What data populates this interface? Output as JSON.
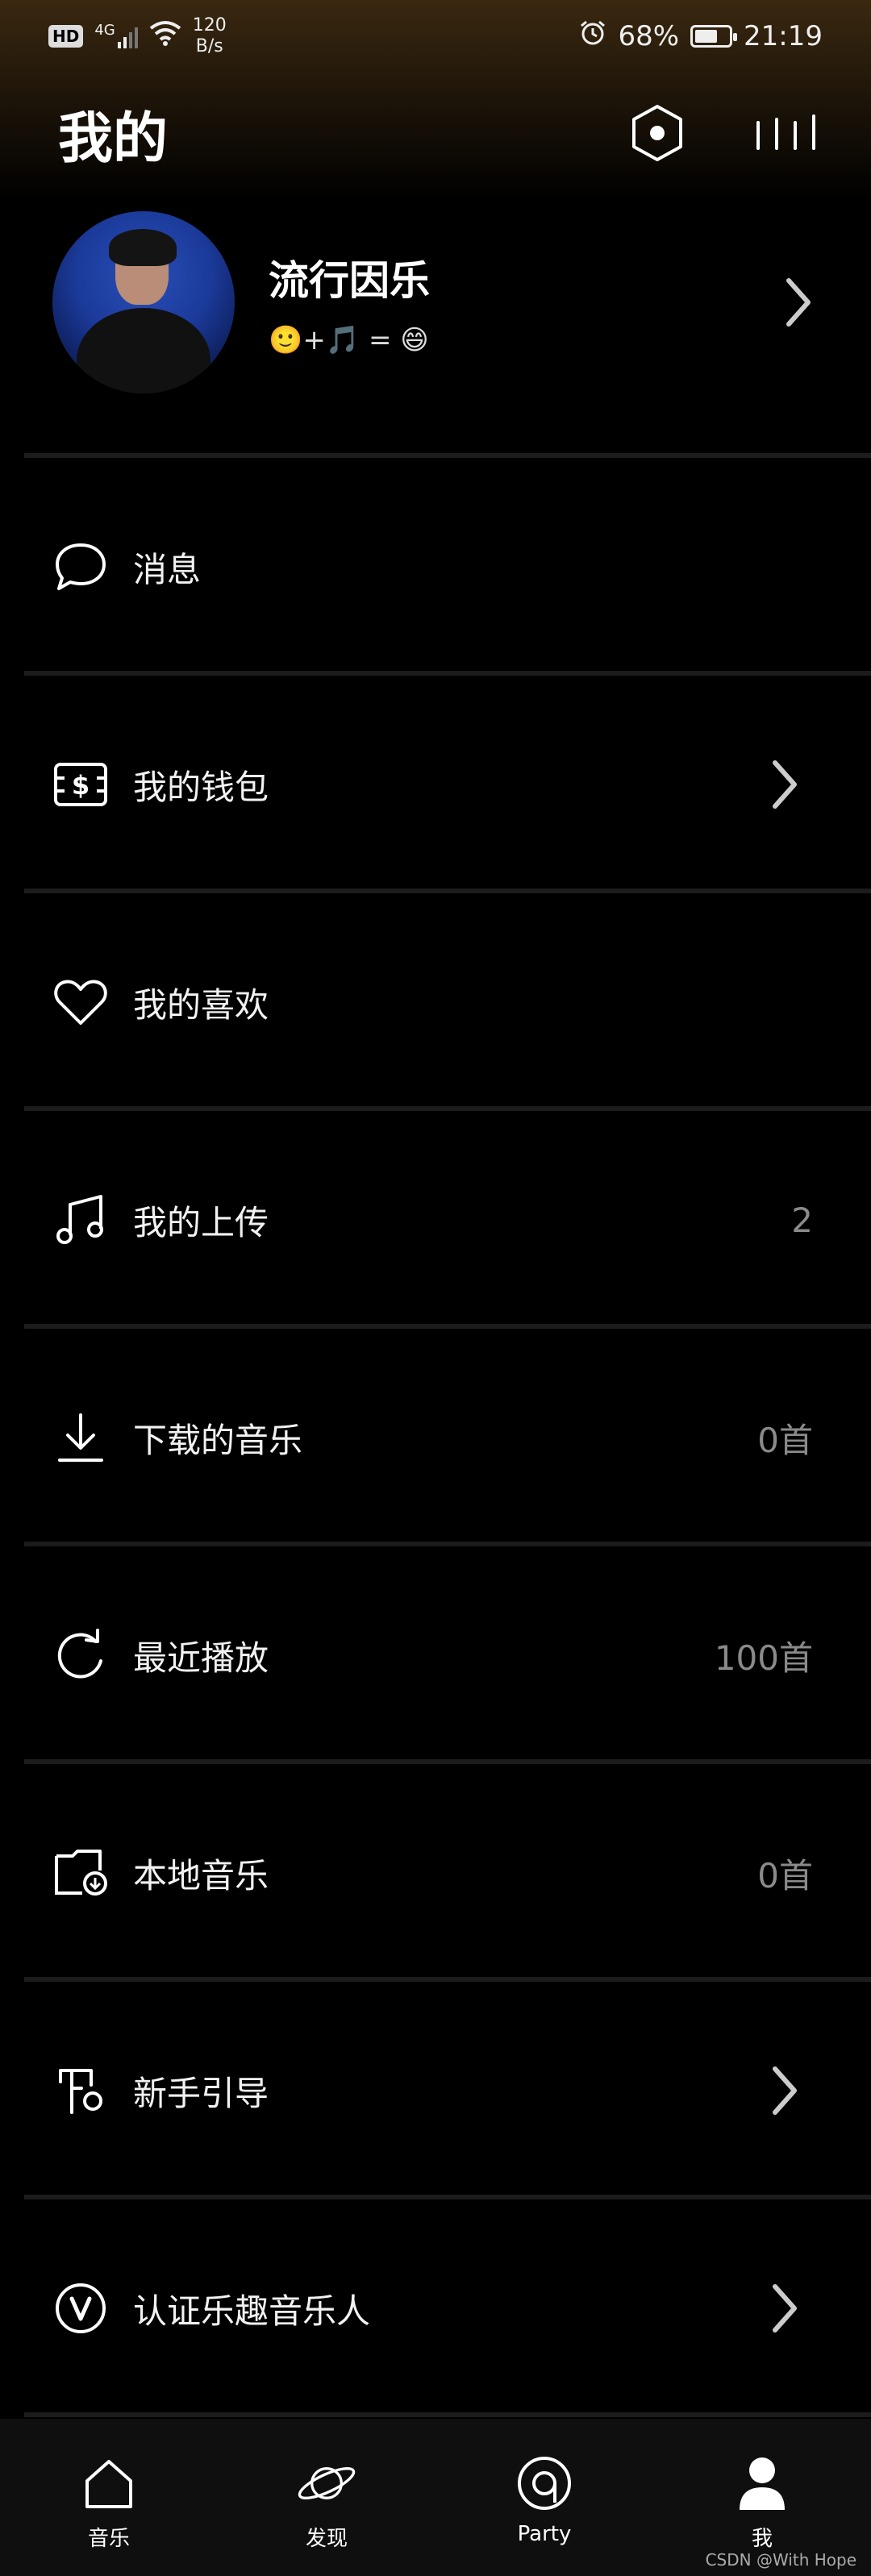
{
  "status_bar": {
    "hd": "HD",
    "network": "4G",
    "speed_value": "120",
    "speed_unit": "B/s",
    "battery": "68%",
    "battery_level": 0.68,
    "time": "21:19"
  },
  "header": {
    "title": "我的",
    "settings_icon": "settings-hex-icon",
    "music_icon": "bars-icon"
  },
  "profile": {
    "name": "流行因乐",
    "signature": "🙂+🎵 = 😄"
  },
  "menu": [
    {
      "label": "消息",
      "icon": "message-bubble-icon",
      "value": "",
      "chevron": false
    },
    {
      "label": "我的钱包",
      "icon": "wallet-icon",
      "value": "",
      "chevron": true
    },
    {
      "label": "我的喜欢",
      "icon": "heart-icon",
      "value": "",
      "chevron": false
    },
    {
      "label": "我的上传",
      "icon": "music-note-icon",
      "value": "2",
      "chevron": false
    },
    {
      "label": "下载的音乐",
      "icon": "download-icon",
      "value": "0首",
      "chevron": false
    },
    {
      "label": "最近播放",
      "icon": "refresh-icon",
      "value": "100首",
      "chevron": false
    },
    {
      "label": "本地音乐",
      "icon": "local-folder-icon",
      "value": "0首",
      "chevron": false
    },
    {
      "label": "新手引导",
      "icon": "guide-icon",
      "value": "",
      "chevron": true
    },
    {
      "label": "认证乐趣音乐人",
      "icon": "verified-v-icon",
      "value": "",
      "chevron": true
    }
  ],
  "bottom_nav": [
    {
      "label": "音乐",
      "icon": "home-icon"
    },
    {
      "label": "发现",
      "icon": "planet-icon"
    },
    {
      "label": "Party",
      "icon": "party-disc-icon"
    },
    {
      "label": "我",
      "icon": "user-icon"
    }
  ],
  "watermark": "CSDN @With Hope"
}
